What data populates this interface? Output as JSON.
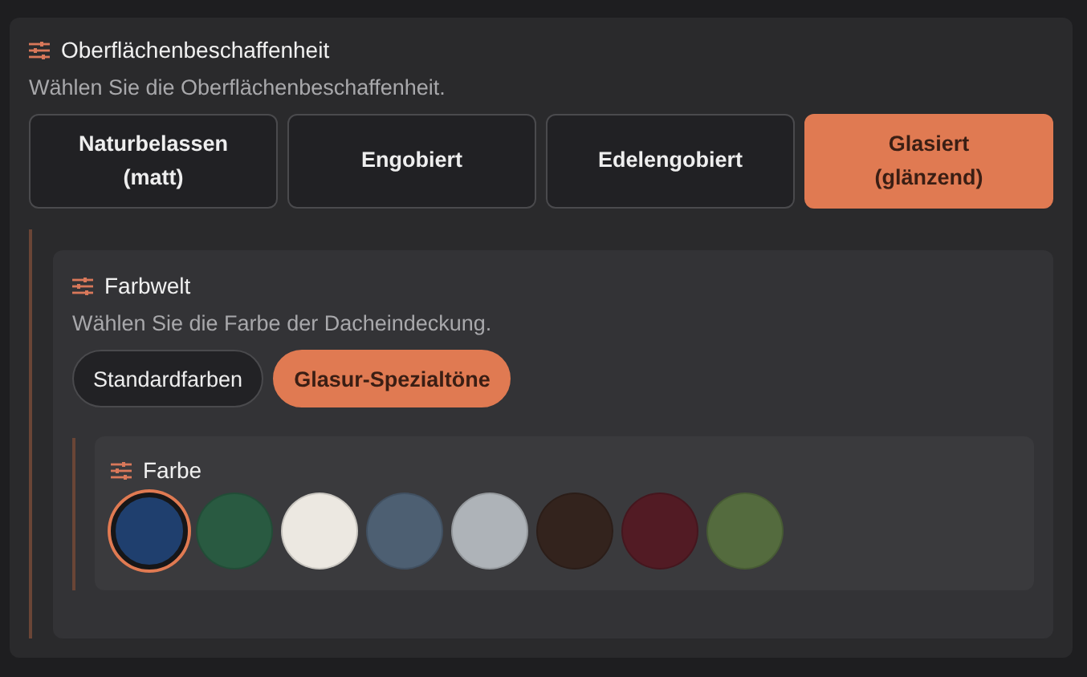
{
  "section": {
    "title": "Oberflächenbeschaffenheit",
    "description": "Wählen Sie die Oberflächenbeschaffenheit.",
    "options": [
      {
        "label": "Naturbelassen (matt)",
        "selected": false
      },
      {
        "label": "Engobiert",
        "selected": false
      },
      {
        "label": "Edelengobiert",
        "selected": false
      },
      {
        "label": "Glasiert (glänzend)",
        "selected": true
      }
    ],
    "subsection": {
      "title": "Farbwelt",
      "description": "Wählen Sie die Farbe der Dacheindeckung.",
      "options": [
        {
          "label": "Standardfarben",
          "selected": false
        },
        {
          "label": "Glasur-Spezialtöne",
          "selected": true
        }
      ],
      "colors": {
        "title": "Farbe",
        "swatches": [
          {
            "color": "#1f3f6e",
            "selected": true
          },
          {
            "color": "#295a41",
            "selected": false
          },
          {
            "color": "#ece8e1",
            "selected": false
          },
          {
            "color": "#4d5f72",
            "selected": false
          },
          {
            "color": "#aeb3b8",
            "selected": false
          },
          {
            "color": "#33231d",
            "selected": false
          },
          {
            "color": "#521b24",
            "selected": false
          },
          {
            "color": "#546b3e",
            "selected": false
          }
        ]
      }
    }
  }
}
